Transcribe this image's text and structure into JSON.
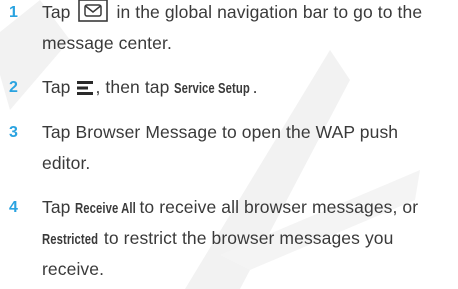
{
  "steps": [
    {
      "number": "1",
      "line1_a": "Tap",
      "icon": "message-center-envelope-icon",
      "line1_b": "in the global navigation bar to go to the",
      "line2": "message center."
    },
    {
      "number": "2",
      "line1_a": "Tap",
      "icon": "menu-icon",
      "line1_b": ", then tap",
      "line1_bold": "Service Setup",
      "line1_end": "."
    },
    {
      "number": "3",
      "line1": "Tap Browser Message to open the WAP push",
      "line2": "editor."
    },
    {
      "number": "4",
      "line1_a": "Tap",
      "line1_bold": "Receive All",
      "line1_b": "to receive all browser messages, or",
      "line2_bold": "Restricted",
      "line2_b": "to restrict the browser messages you",
      "line3": "receive."
    }
  ],
  "colors": {
    "step_number": "#2aa3e0",
    "body_text": "#3a3a3a",
    "watermark": "#f1f1f1"
  }
}
